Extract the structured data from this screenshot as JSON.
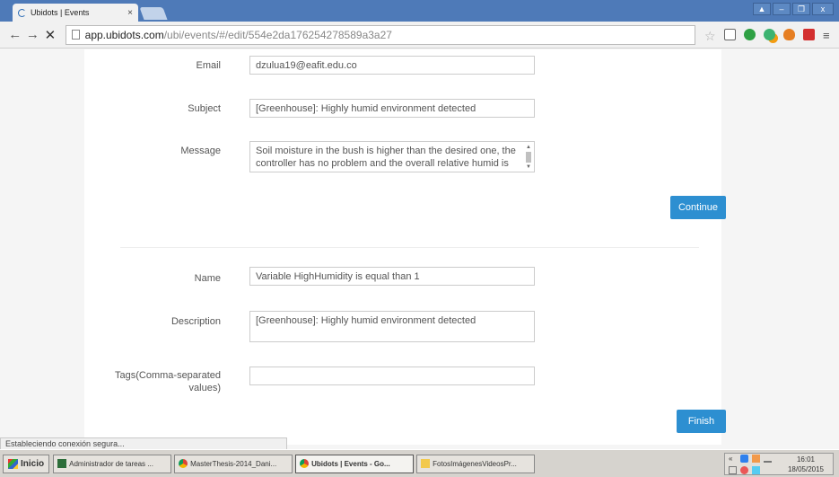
{
  "browser": {
    "tab_title": "Ubidots | Events",
    "tab_close": "×",
    "url_host": "app.ubidots.com",
    "url_path": "/ubi/events/#/edit/554e2da176254278589a3a27",
    "back_glyph": "←",
    "forward_glyph": "→",
    "stop_glyph": "✕",
    "bookmark_glyph": "☆",
    "window_buttons": [
      "▲",
      "–",
      "❐",
      "x"
    ],
    "menu_glyph": "≡"
  },
  "form_action": {
    "email_label": "Email",
    "email_value": "dzulua19@eafit.edu.co",
    "subject_label": "Subject",
    "subject_value": "[Greenhouse]: Highly humid environment detected",
    "message_label": "Message",
    "message_value": "Soil moisture in the bush is higher than the desired one, the controller has no problem and the overall relative humid is",
    "continue_label": "Continue"
  },
  "form_event": {
    "name_label": "Name",
    "name_value": "Variable HighHumidity is equal than 1",
    "description_label": "Description",
    "description_value": "[Greenhouse]: Highly humid environment detected",
    "tags_label": "Tags(Comma-separated values)",
    "tags_value": "",
    "finish_label": "Finish"
  },
  "status_text": "Estableciendo conexión segura...",
  "taskbar": {
    "start_label": "Inicio",
    "tasks": [
      "Administrador de tareas ...",
      "MasterThesis-2014_Dani...",
      "Ubidots | Events - Go...",
      "FotosImágenesVideosPr..."
    ],
    "time": "16:01",
    "date": "18/05/2015"
  },
  "colors": {
    "accent": "#2d8fd1",
    "tabbar": "#4e7ab8"
  }
}
